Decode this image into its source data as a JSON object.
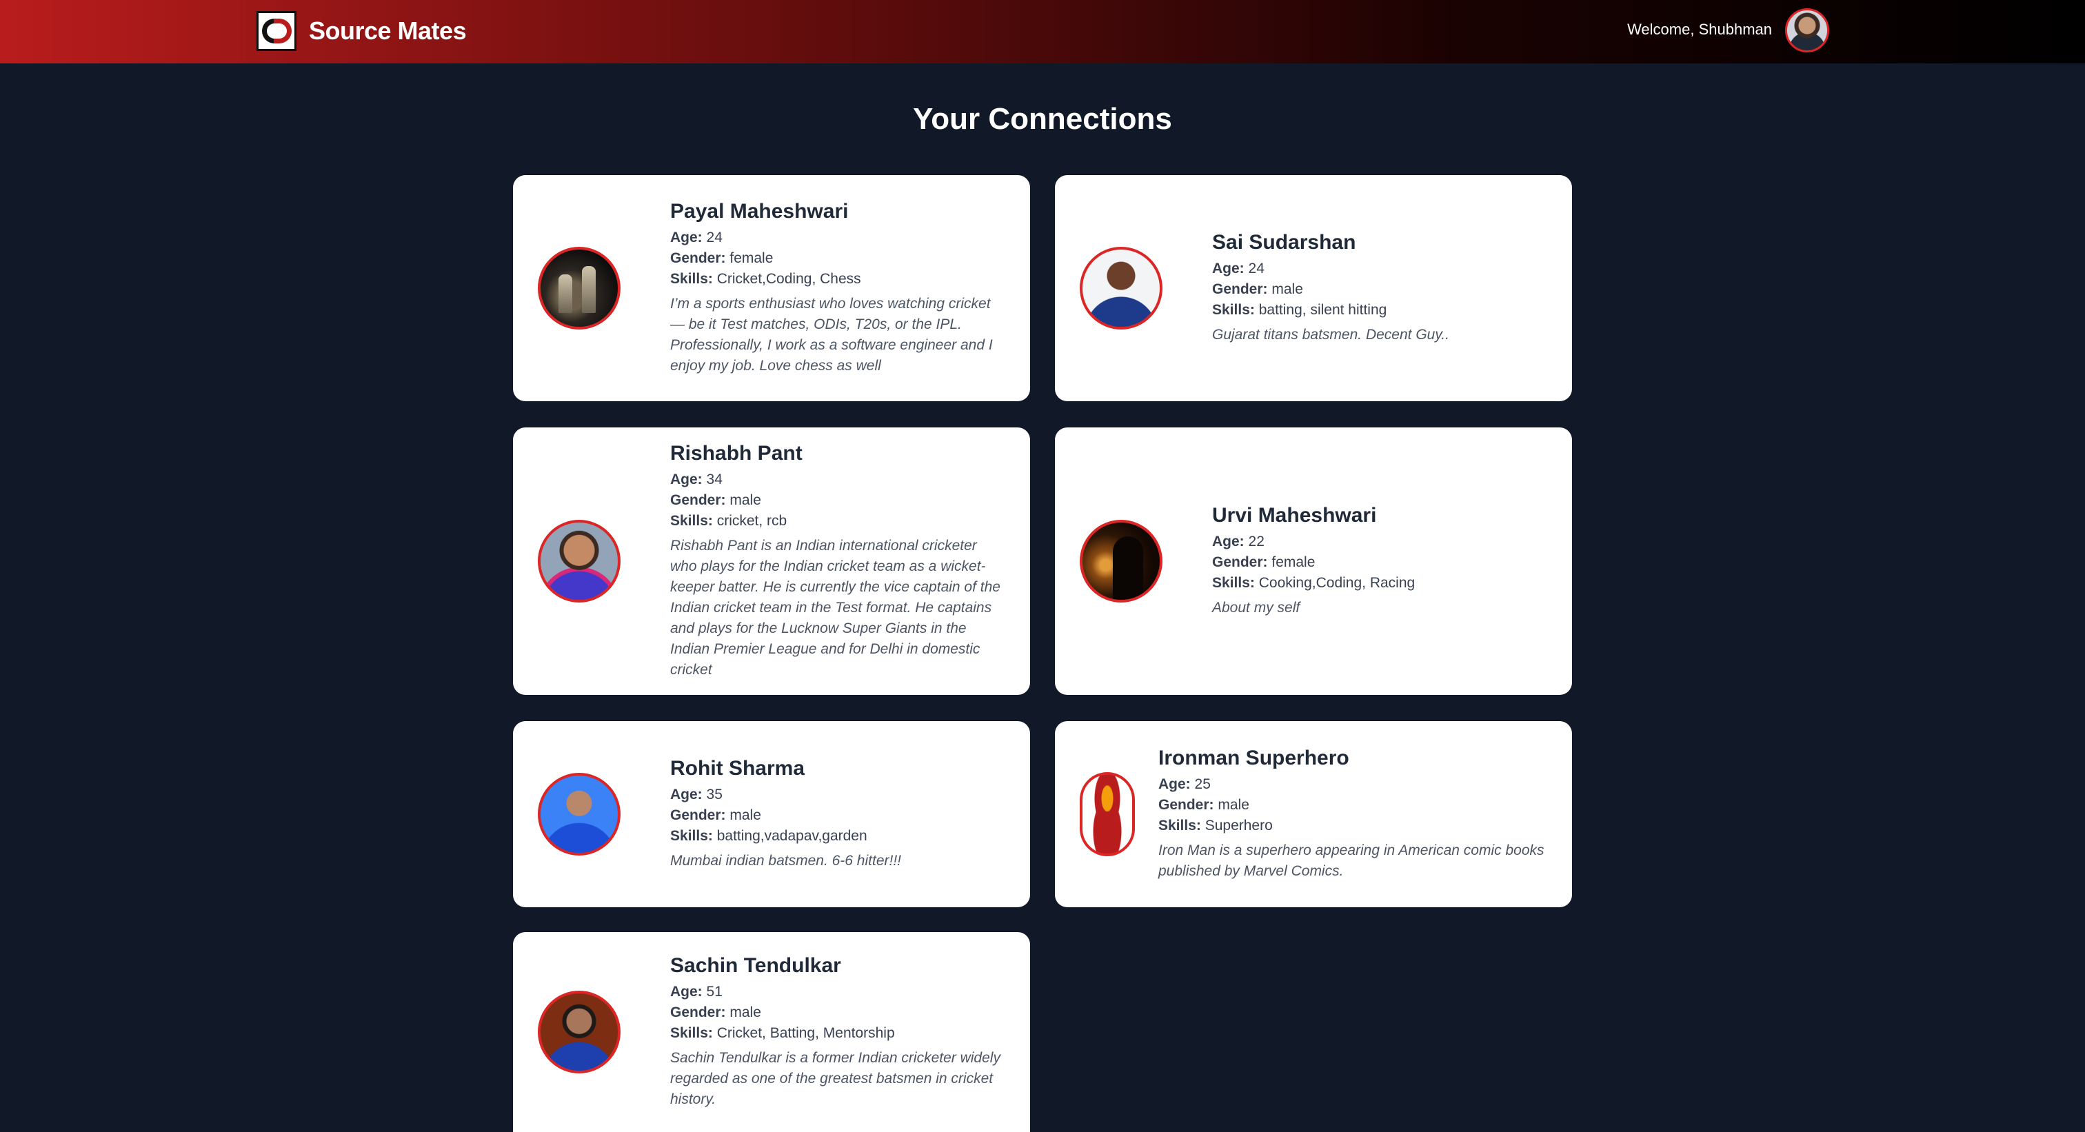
{
  "navbar": {
    "brand": "Source Mates",
    "welcome": "Welcome, Shubhman"
  },
  "page": {
    "title": "Your Connections"
  },
  "labels": {
    "age": "Age:",
    "gender": "Gender:",
    "skills": "Skills:"
  },
  "connections": [
    {
      "name": "Payal Maheshwari",
      "age": "24",
      "gender": "female",
      "skills": "Cricket,Coding, Chess",
      "bio": "I’m a sports enthusiast who loves watching cricket — be it Test matches, ODIs, T20s, or the IPL. Professionally, I work as a software engineer and I enjoy my job. Love chess as well",
      "avatar_icon": "chess-pieces-photo"
    },
    {
      "name": "Sai Sudarshan",
      "age": "24",
      "gender": "male",
      "skills": "batting, silent hitting",
      "bio": "Gujarat titans batsmen. Decent Guy..",
      "avatar_icon": "cricketer-photo"
    },
    {
      "name": "Rishabh Pant",
      "age": "34",
      "gender": "male",
      "skills": "cricket, rcb",
      "bio": "Rishabh Pant is an Indian international cricketer who plays for the Indian cricket team as a wicket-keeper batter. He is currently the vice captain of the Indian cricket team in the Test format. He captains and plays for the Lucknow Super Giants in the Indian Premier League and for Delhi in domestic cricket",
      "avatar_icon": "cricketer-photo"
    },
    {
      "name": "Urvi Maheshwari",
      "age": "22",
      "gender": "female",
      "skills": "Cooking,Coding, Racing",
      "bio": "About my self",
      "avatar_icon": "sunset-silhouette-photo"
    },
    {
      "name": "Rohit Sharma",
      "age": "35",
      "gender": "male",
      "skills": "batting,vadapav,garden",
      "bio": "Mumbai indian batsmen. 6-6 hitter!!!",
      "avatar_icon": "cricketer-photo"
    },
    {
      "name": "Ironman Superhero",
      "age": "25",
      "gender": "male",
      "skills": "Superhero",
      "bio": "Iron Man is a superhero appearing in American comic books published by Marvel Comics.",
      "avatar_icon": "ironman-photo"
    },
    {
      "name": "Sachin Tendulkar",
      "age": "51",
      "gender": "male",
      "skills": "Cricket, Batting, Mentorship",
      "bio": "Sachin Tendulkar is a former Indian cricketer widely regarded as one of the greatest batsmen in cricket history.",
      "avatar_icon": "cricketer-photo"
    }
  ],
  "colors": {
    "accent": "#dc2626",
    "background": "#111827",
    "card": "#ffffff"
  }
}
